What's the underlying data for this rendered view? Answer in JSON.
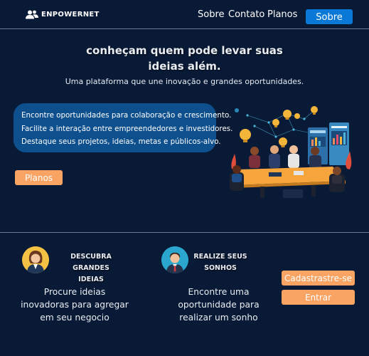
{
  "nav": {
    "logo_text": "ENPOWERNET",
    "links": [
      "Sobre",
      "Contato",
      "Planos"
    ],
    "button_label": "Sobre"
  },
  "hero": {
    "title_line1": "conheçam quem pode levar suas",
    "title_line2": "ideias além.",
    "subtitle": "Uma plataforma que une inovação e grandes oportunidades."
  },
  "features_card": {
    "lines": [
      "Encontre oportunidades para colaboração e crescimento.",
      "Facilite a interação entre empreendedores e investidores.",
      "Destaque seus projetos, ideias, metas e públicos-alvo."
    ]
  },
  "plans_button": "Planos",
  "sections": [
    {
      "heading_line1": "DESCUBRA GRANDES",
      "heading_line2": "IDEIAS",
      "text_lines": [
        "Procure ideias",
        "inovadoras para agregar",
        "em seu negocio"
      ]
    },
    {
      "heading_line1": "REALIZE SEUS",
      "heading_line2": "SONHOS",
      "text_lines": [
        "Encontre uma",
        "oportunidade para",
        "realizar um sonho"
      ]
    }
  ],
  "auth": {
    "register_label": "Cadastrastre-se",
    "login_label": "Entrar"
  },
  "colors": {
    "background": "#091a36",
    "primary_button": "#0a78d6",
    "accent_orange": "#f9a463",
    "card_blue": "#0e4f8e"
  },
  "icons": [
    "users-icon",
    "woman-avatar-icon",
    "man-avatar-icon"
  ]
}
